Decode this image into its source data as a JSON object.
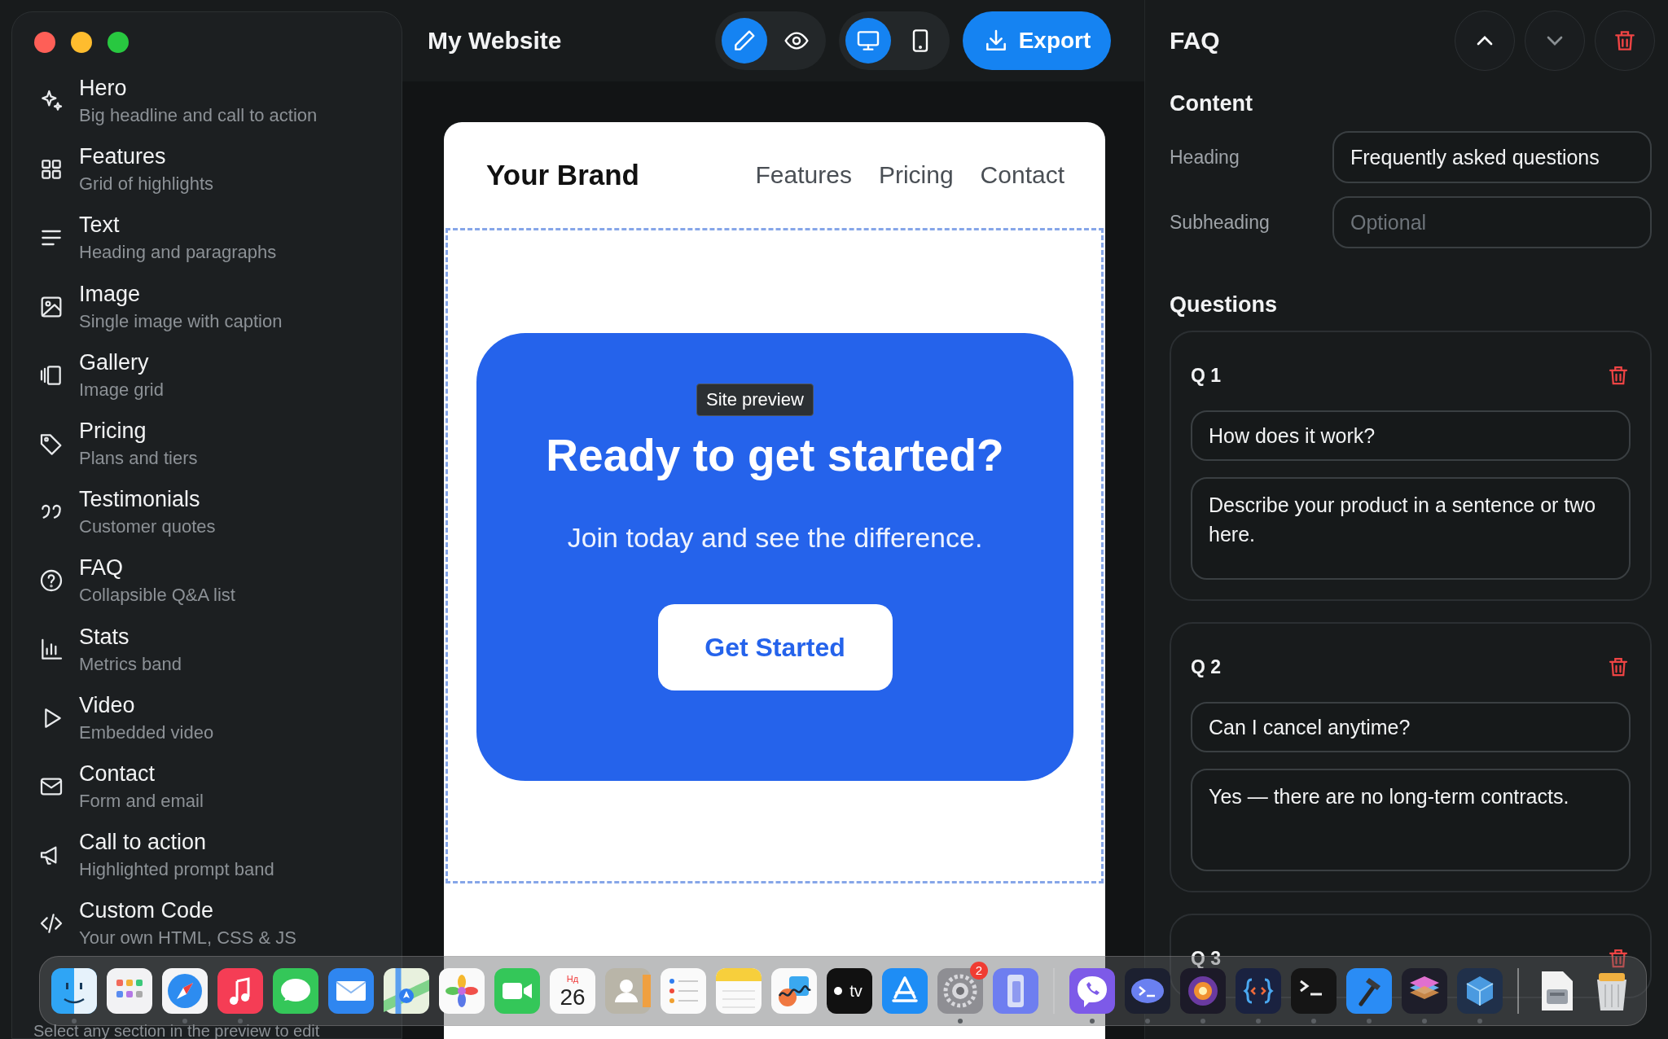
{
  "window": {
    "title": "My Website"
  },
  "sidebar": {
    "items": [
      {
        "kind": "sparkle",
        "title": "Hero",
        "subtitle": "Big headline and call to action"
      },
      {
        "kind": "grid",
        "title": "Features",
        "subtitle": "Grid of highlights"
      },
      {
        "kind": "lines",
        "title": "Text",
        "subtitle": "Heading and paragraphs"
      },
      {
        "kind": "image",
        "title": "Image",
        "subtitle": "Single image with caption"
      },
      {
        "kind": "gallery",
        "title": "Gallery",
        "subtitle": "Image grid"
      },
      {
        "kind": "tag",
        "title": "Pricing",
        "subtitle": "Plans and tiers"
      },
      {
        "kind": "quote",
        "title": "Testimonials",
        "subtitle": "Customer quotes"
      },
      {
        "kind": "question",
        "title": "FAQ",
        "subtitle": "Collapsible Q&A list"
      },
      {
        "kind": "chart",
        "title": "Stats",
        "subtitle": "Metrics band"
      },
      {
        "kind": "play",
        "title": "Video",
        "subtitle": "Embedded video"
      },
      {
        "kind": "envelope",
        "title": "Contact",
        "subtitle": "Form and email"
      },
      {
        "kind": "megaphone",
        "title": "Call to action",
        "subtitle": "Highlighted prompt band"
      },
      {
        "kind": "code",
        "title": "Custom Code",
        "subtitle": "Your own HTML, CSS & JS"
      }
    ],
    "footer": "Select any section in the preview to edit"
  },
  "toolbar": {
    "modes": [
      {
        "kind": "pencil",
        "selected": true
      },
      {
        "kind": "eye",
        "selected": false
      }
    ],
    "devices": [
      {
        "kind": "desktop",
        "selected": true
      },
      {
        "kind": "phone",
        "selected": false
      }
    ],
    "export": "Export"
  },
  "preview": {
    "brand": "Your Brand",
    "nav": [
      "Features",
      "Pricing",
      "Contact"
    ],
    "tooltip": "Site preview",
    "cta": {
      "heading": "Ready to get started?",
      "text": "Join today and see the difference.",
      "button": "Get Started"
    }
  },
  "inspector": {
    "title": "FAQ",
    "content_heading": "Content",
    "fields": [
      {
        "label": "Heading",
        "value": "Frequently asked questions"
      },
      {
        "label": "Subheading",
        "placeholder": "Optional"
      }
    ],
    "questions_heading": "Questions",
    "questions": [
      {
        "label": "Q 1",
        "question": "How does it work?",
        "answer": "Describe your product in a sentence or two here."
      },
      {
        "label": "Q 2",
        "question": "Can I cancel anytime?",
        "answer": "Yes — there are no long-term contracts."
      },
      {
        "label": "Q 3"
      }
    ]
  },
  "dock": [
    {
      "kind": "finder",
      "running": true
    },
    {
      "kind": "launchpad",
      "running": false
    },
    {
      "kind": "safari",
      "running": true
    },
    {
      "kind": "music",
      "running": true
    },
    {
      "kind": "messages",
      "running": false
    },
    {
      "kind": "mail",
      "running": false
    },
    {
      "kind": "maps",
      "running": false
    },
    {
      "kind": "photos",
      "running": false
    },
    {
      "kind": "facetime",
      "running": false
    },
    {
      "kind": "calendar",
      "running": false,
      "month": "Нд",
      "day": "26"
    },
    {
      "kind": "contacts",
      "running": false
    },
    {
      "kind": "reminders",
      "running": false
    },
    {
      "kind": "notes",
      "running": false
    },
    {
      "kind": "freeform",
      "running": false
    },
    {
      "kind": "tv",
      "running": false,
      "label": "tv"
    },
    {
      "kind": "appstore",
      "running": false
    },
    {
      "kind": "settings",
      "running": true,
      "badge": "2"
    },
    {
      "kind": "mirroring",
      "running": false
    },
    {
      "kind": "separator"
    },
    {
      "kind": "viber",
      "running": true
    },
    {
      "kind": "prompt",
      "running": true
    },
    {
      "kind": "orb",
      "running": true
    },
    {
      "kind": "braces",
      "running": true
    },
    {
      "kind": "terminal",
      "running": true
    },
    {
      "kind": "hammer",
      "running": true
    },
    {
      "kind": "layers",
      "running": true
    },
    {
      "kind": "cube",
      "running": true
    },
    {
      "kind": "separator"
    },
    {
      "kind": "drive",
      "running": false
    },
    {
      "kind": "trash",
      "running": false
    }
  ]
}
